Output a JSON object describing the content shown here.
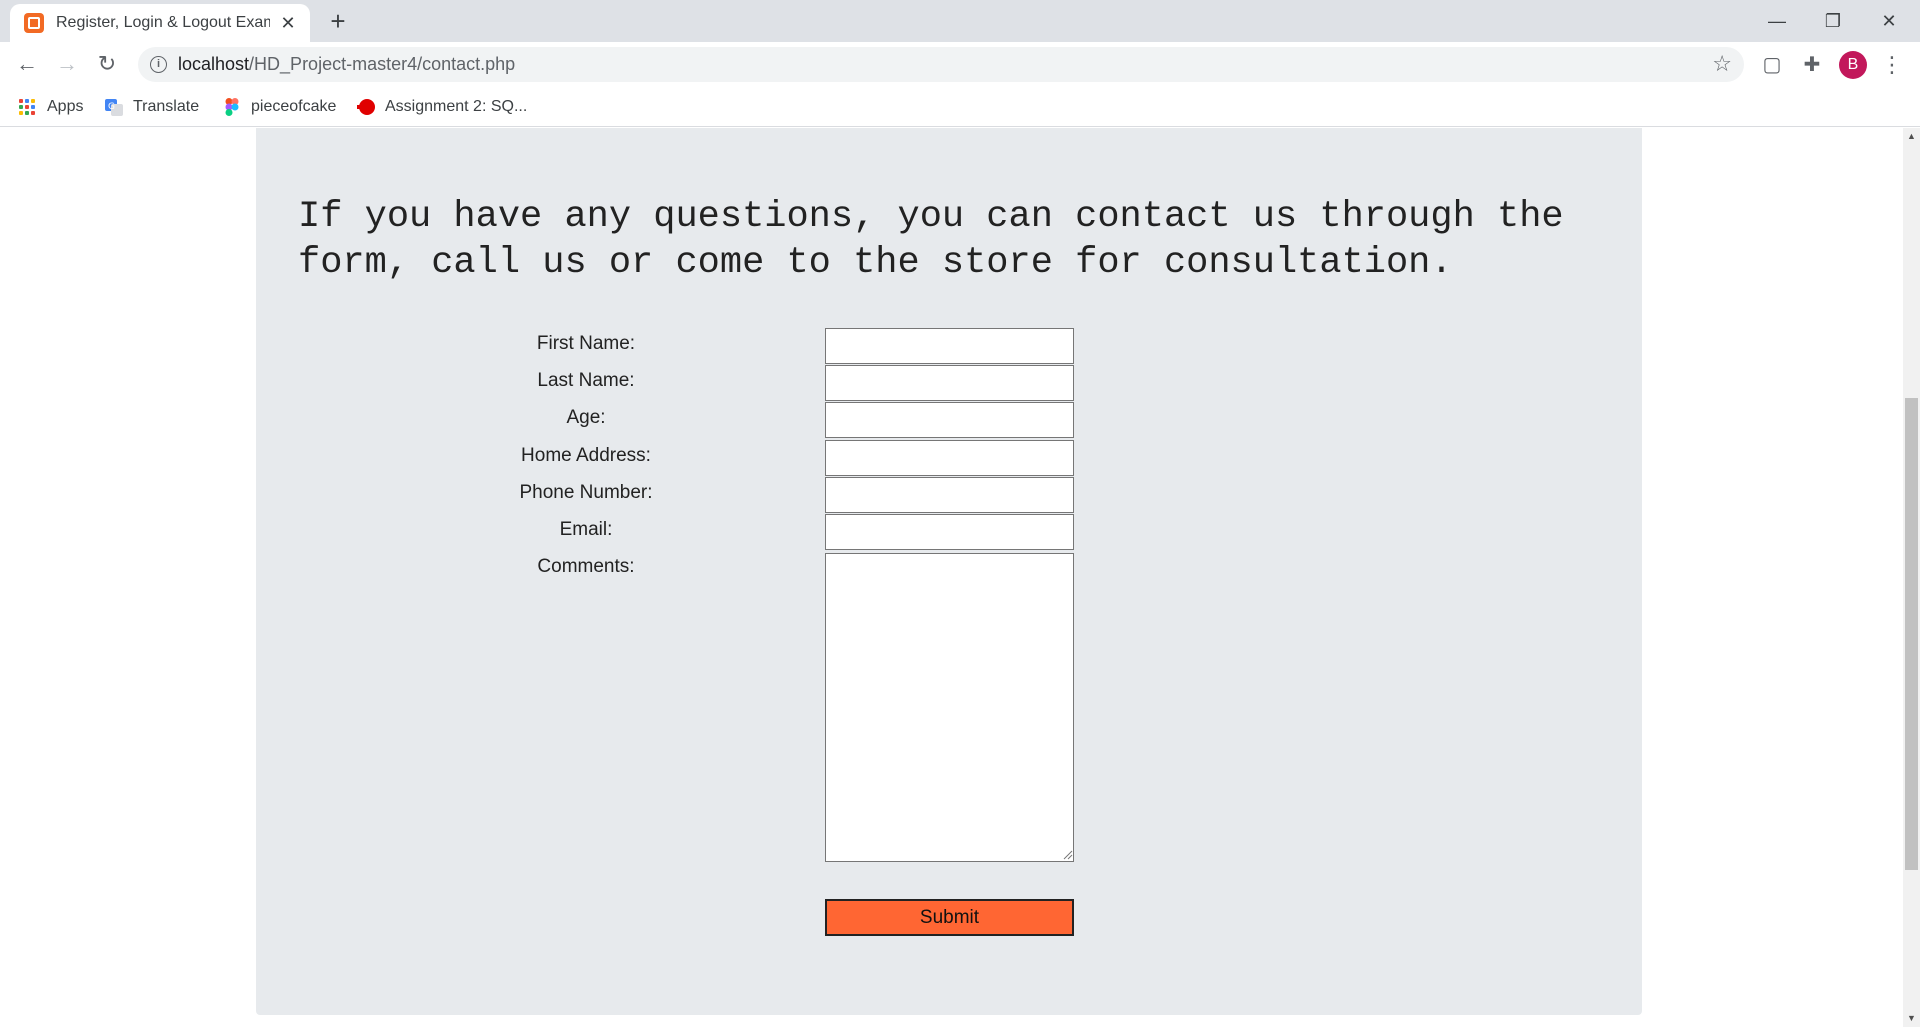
{
  "browser": {
    "tab_title": "Register, Login & Logout Exam",
    "url_host": "localhost",
    "url_path": "/HD_Project-master4/contact.php",
    "avatar_initial": "B",
    "bookmarks": [
      {
        "label": "Apps",
        "icon": "apps-grid-icon"
      },
      {
        "label": "Translate",
        "icon": "translate-icon"
      },
      {
        "label": "pieceofcake",
        "icon": "figma-icon"
      },
      {
        "label": "Assignment 2: SQ...",
        "icon": "red-blob-icon"
      }
    ]
  },
  "page": {
    "intro": "If you have any questions, you can contact us through the form, call us or come to the store for consultation.",
    "form": {
      "first_name_label": "First Name:",
      "last_name_label": "Last Name:",
      "age_label": "Age:",
      "address_label": "Home Address:",
      "phone_label": "Phone Number:",
      "email_label": "Email:",
      "comments_label": "Comments:",
      "submit_label": "Submit"
    }
  },
  "colors": {
    "panel_bg": "#e7eaed",
    "submit_bg": "#ff6633",
    "avatar_bg": "#c2185b",
    "favicon": "#f26a24"
  }
}
